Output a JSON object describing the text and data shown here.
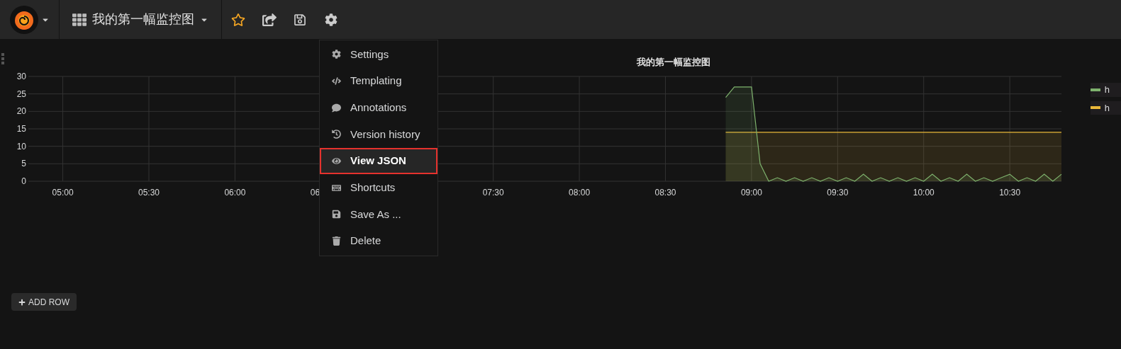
{
  "navbar": {
    "dashboard_title": "我的第一幅监控图"
  },
  "settings_menu": {
    "items": [
      {
        "label": "Settings",
        "selected": false
      },
      {
        "label": "Templating",
        "selected": false
      },
      {
        "label": "Annotations",
        "selected": false
      },
      {
        "label": "Version history",
        "selected": false
      },
      {
        "label": "View JSON",
        "selected": true
      },
      {
        "label": "Shortcuts",
        "selected": false
      },
      {
        "label": "Save As ...",
        "selected": false
      },
      {
        "label": "Delete",
        "selected": false
      }
    ]
  },
  "panel": {
    "title": "我的第一幅监控图",
    "chart_data": {
      "type": "area",
      "grid": true,
      "ylim": [
        0,
        30
      ],
      "yticks": [
        0,
        5,
        10,
        15,
        20,
        25,
        30
      ],
      "categories": [
        null,
        null,
        null,
        null,
        "05:00",
        null,
        null,
        null,
        null,
        null,
        null,
        null,
        null,
        null,
        "05:30",
        null,
        null,
        null,
        null,
        null,
        null,
        null,
        null,
        null,
        "06:00",
        null,
        null,
        null,
        null,
        null,
        null,
        null,
        null,
        null,
        "06",
        null,
        null,
        null,
        null,
        null,
        null,
        null,
        null,
        null,
        null,
        null,
        null,
        null,
        null,
        null,
        null,
        null,
        null,
        null,
        "07:30",
        null,
        null,
        null,
        null,
        null,
        null,
        null,
        null,
        null,
        "08:00",
        null,
        null,
        null,
        null,
        null,
        null,
        null,
        null,
        null,
        "08:30",
        null,
        null,
        null,
        null,
        null,
        null,
        null,
        null,
        null,
        "09:00",
        null,
        null,
        null,
        null,
        null,
        null,
        null,
        null,
        null,
        "09:30",
        null,
        null,
        null,
        null,
        null,
        null,
        null,
        null,
        null,
        "10:00",
        null,
        null,
        null,
        null,
        null,
        null,
        null,
        null,
        null,
        "10:30",
        null,
        null,
        null,
        null,
        null,
        null
      ],
      "series": [
        {
          "name": "h",
          "color": "#7eb26d",
          "values": [
            null,
            null,
            null,
            null,
            null,
            null,
            null,
            null,
            null,
            null,
            null,
            null,
            null,
            null,
            null,
            null,
            null,
            null,
            null,
            null,
            null,
            null,
            null,
            null,
            null,
            null,
            null,
            null,
            null,
            null,
            null,
            null,
            null,
            null,
            null,
            null,
            null,
            null,
            null,
            null,
            null,
            null,
            null,
            null,
            null,
            null,
            null,
            null,
            null,
            null,
            null,
            null,
            null,
            null,
            null,
            null,
            null,
            null,
            null,
            null,
            null,
            null,
            null,
            null,
            null,
            null,
            null,
            null,
            null,
            null,
            null,
            null,
            null,
            null,
            null,
            null,
            null,
            null,
            null,
            null,
            null,
            24,
            27,
            27,
            27,
            5,
            0,
            1,
            0,
            1,
            0,
            1,
            0,
            1,
            0,
            1,
            0,
            2,
            0,
            1,
            0,
            1,
            0,
            1,
            0,
            2,
            0,
            1,
            0,
            2,
            0,
            1,
            0,
            1,
            2,
            0,
            1,
            0,
            2,
            0,
            2
          ]
        },
        {
          "name": "h",
          "color": "#eab839",
          "values": [
            null,
            null,
            null,
            null,
            null,
            null,
            null,
            null,
            null,
            null,
            null,
            null,
            null,
            null,
            null,
            null,
            null,
            null,
            null,
            null,
            null,
            null,
            null,
            null,
            null,
            null,
            null,
            null,
            null,
            null,
            null,
            null,
            null,
            null,
            null,
            null,
            null,
            null,
            null,
            null,
            null,
            null,
            null,
            null,
            null,
            null,
            null,
            null,
            null,
            null,
            null,
            null,
            null,
            null,
            null,
            null,
            null,
            null,
            null,
            null,
            null,
            null,
            null,
            null,
            null,
            null,
            null,
            null,
            null,
            null,
            null,
            null,
            null,
            null,
            null,
            null,
            null,
            null,
            null,
            null,
            null,
            14,
            14,
            14,
            14,
            14,
            14,
            14,
            14,
            14,
            14,
            14,
            14,
            14,
            14,
            14,
            14,
            14,
            14,
            14,
            14,
            14,
            14,
            14,
            14,
            14,
            14,
            14,
            14,
            14,
            14,
            14,
            14,
            14,
            14,
            14,
            14,
            14,
            14,
            14,
            14
          ]
        }
      ]
    }
  },
  "add_row_button": {
    "label": "ADD ROW"
  }
}
